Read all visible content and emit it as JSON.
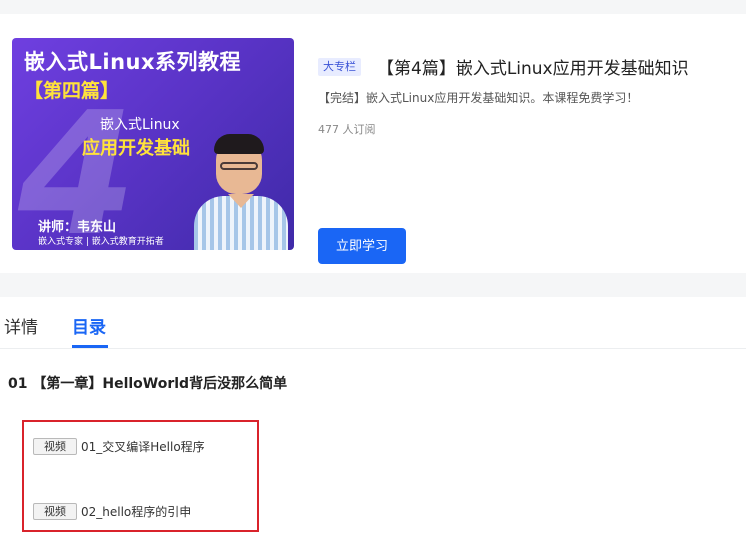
{
  "course": {
    "cover": {
      "big_number": "4",
      "title": "嵌入式Linux系列教程",
      "badge": "【第四篇】",
      "subtitle_line1": "嵌入式Linux",
      "subtitle_line2": "应用开发基础",
      "teacher": "讲师：韦东山",
      "tagline": "嵌入式专家 | 嵌入式教育开拓者"
    },
    "badge": "大专栏",
    "title": "【第4篇】嵌入式Linux应用开发基础知识",
    "description": "【完结】嵌入式Linux应用开发基础知识。本课程免费学习！",
    "subscribers": "477 人订阅",
    "study_button": "立即学习"
  },
  "tabs": [
    {
      "label": "详情",
      "active": false
    },
    {
      "label": "目录",
      "active": true
    }
  ],
  "chapter": {
    "title": "01 【第一章】HelloWorld背后没那么简单",
    "lessons": [
      {
        "type": "视频",
        "title": "01_交叉编译Hello程序"
      },
      {
        "type": "视频",
        "title": "02_hello程序的引申"
      }
    ]
  },
  "colors": {
    "accent": "#1a66f5",
    "highlight_border": "#d9232b",
    "cover_bg": "#5b34c8"
  }
}
